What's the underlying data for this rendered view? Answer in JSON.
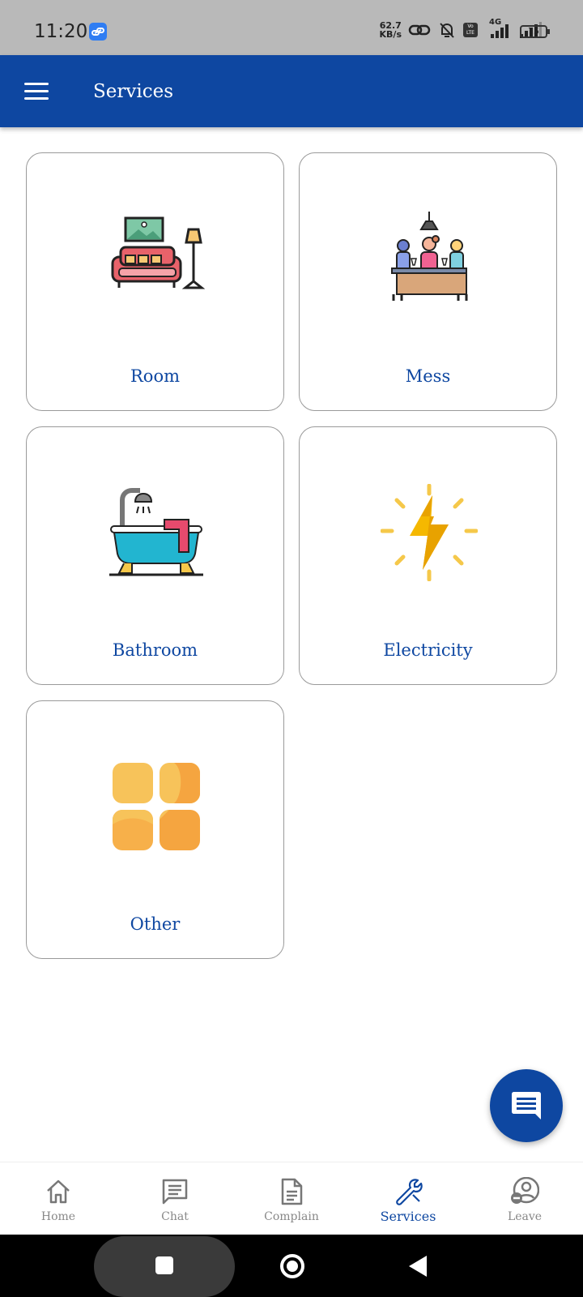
{
  "status_bar": {
    "time": "11:20",
    "net_speed_value": "62.7",
    "net_speed_unit": "KB/s",
    "network": "4G",
    "volte": "Vo LTE",
    "battery": "75"
  },
  "app_bar": {
    "title": "Services",
    "menu_icon": "hamburger-menu-icon"
  },
  "services": [
    {
      "label": "Room",
      "icon": "sofa-lamp-icon"
    },
    {
      "label": "Mess",
      "icon": "dining-table-icon"
    },
    {
      "label": "Bathroom",
      "icon": "bathtub-shower-icon"
    },
    {
      "label": "Electricity",
      "icon": "lightning-bolt-icon"
    },
    {
      "label": "Other",
      "icon": "grid-tiles-icon"
    }
  ],
  "fab": {
    "icon": "chat-message-icon"
  },
  "bottom_nav": {
    "active": "Services",
    "items": [
      {
        "label": "Home",
        "icon": "home-icon"
      },
      {
        "label": "Chat",
        "icon": "chat-icon"
      },
      {
        "label": "Complain",
        "icon": "document-icon"
      },
      {
        "label": "Services",
        "icon": "wrench-icon"
      },
      {
        "label": "Leave",
        "icon": "user-remove-icon"
      }
    ]
  },
  "colors": {
    "primary": "#0e47a1",
    "status_bar": "#b9b9b9",
    "inactive_nav": "#888888"
  }
}
